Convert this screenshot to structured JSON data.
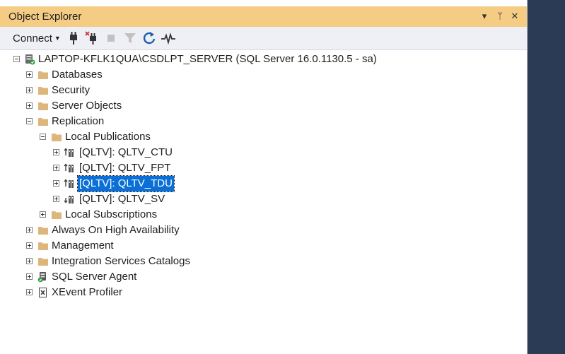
{
  "panel": {
    "title": "Object Explorer",
    "controls": {
      "dropdown": "▾",
      "pin": "ᛘ",
      "close": "✕"
    }
  },
  "toolbar": {
    "connect_label": "Connect",
    "icons": [
      "connect-plug-icon",
      "disconnect-icon",
      "stop-icon",
      "filter-icon",
      "refresh-icon",
      "activity-monitor-icon"
    ]
  },
  "colors": {
    "title_bar": "#f5cc84",
    "selection": "#0a6fd6",
    "folder": "#dcb67a",
    "background": "#2b3a55"
  },
  "tree": {
    "server": "LAPTOP-KFLK1QUA\\CSDLPT_SERVER (SQL Server 16.0.1130.5 - sa)",
    "databases": "Databases",
    "security": "Security",
    "server_objects": "Server Objects",
    "replication": "Replication",
    "local_publications": "Local Publications",
    "pubs": [
      "[QLTV]: QLTV_CTU",
      "[QLTV]: QLTV_FPT",
      "[QLTV]: QLTV_TDU",
      "[QLTV]: QLTV_SV"
    ],
    "local_subscriptions": "Local Subscriptions",
    "always_on": "Always On High Availability",
    "management": "Management",
    "integration_services": "Integration Services Catalogs",
    "sql_agent": "SQL Server Agent",
    "xevent": "XEvent Profiler"
  }
}
